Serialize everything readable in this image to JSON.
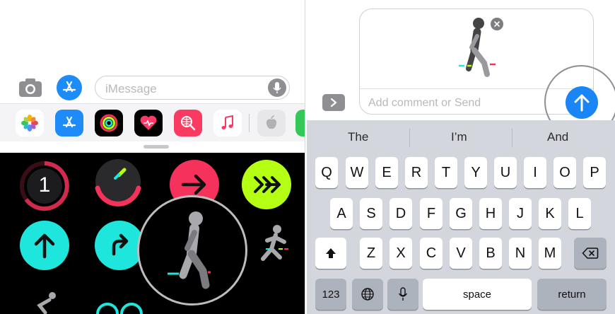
{
  "left": {
    "compose": {
      "placeholder": "iMessage",
      "camera_icon": "camera-icon",
      "appstore_icon": "app-store-icon",
      "mic_icon": "microphone-icon"
    },
    "app_drawer": [
      "photos-app-icon",
      "app-store-icon",
      "activity-app-icon",
      "heartbeat-app-icon",
      "web-search-app-icon",
      "music-app-icon",
      "apple-app-icon",
      "green-app-icon"
    ],
    "stickers": {
      "ring_number": "1",
      "items": [
        "activity-badge-1",
        "move-ring-sticker",
        "right-arrow-sticker",
        "double-arrow-sticker",
        "up-arrow-sticker",
        "redo-arrow-sticker",
        "walking-figure-sticker",
        "running-figure-sticker",
        "cycling-figure-sticker"
      ]
    }
  },
  "right": {
    "comment_placeholder": "Add comment or Send",
    "suggestions": [
      "The",
      "I’m",
      "And"
    ],
    "keyboard": {
      "row1": [
        "Q",
        "W",
        "E",
        "R",
        "T",
        "Y",
        "U",
        "I",
        "O",
        "P"
      ],
      "row2": [
        "A",
        "S",
        "D",
        "F",
        "G",
        "H",
        "J",
        "K",
        "L"
      ],
      "row3": [
        "Z",
        "X",
        "C",
        "V",
        "B",
        "N",
        "M"
      ],
      "numbers_key": "123",
      "space_key": "space",
      "return_key": "return"
    }
  },
  "colors": {
    "accent_blue": "#1a86f5",
    "activity_red": "#f5325c",
    "activity_green": "#b4ff14",
    "activity_cyan": "#1ee6dc"
  }
}
